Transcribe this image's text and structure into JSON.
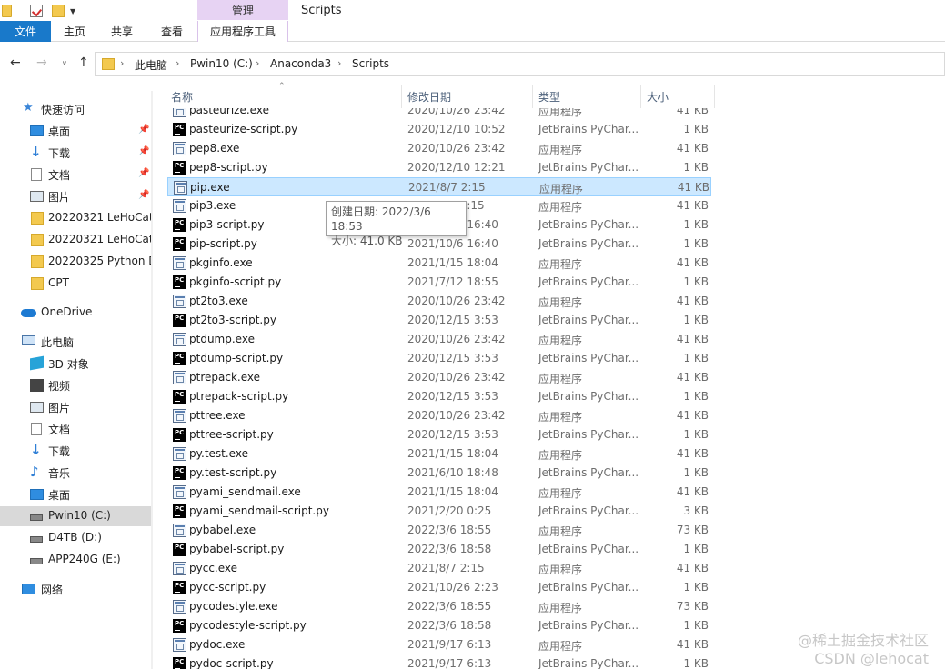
{
  "quick_access_toolbar": {
    "icons": [
      "folder-icon",
      "properties-icon",
      "new-folder-icon",
      "customize-dropdown-icon"
    ]
  },
  "ribbon": {
    "context_group": "管理",
    "window_title": "Scripts",
    "tabs": {
      "file": "文件",
      "home": "主页",
      "share": "共享",
      "view": "查看",
      "app_tools": "应用程序工具"
    },
    "file_tab_color": "#1979ca",
    "context_color": "#e7d3f3"
  },
  "address_bar": {
    "crumbs": [
      "此电脑",
      "Pwin10 (C:)",
      "Anaconda3",
      "Scripts"
    ],
    "separator": "›"
  },
  "nav_pane": {
    "quick_access": "快速访问",
    "pinned": [
      "桌面",
      "下载",
      "文档",
      "图片"
    ],
    "recent": [
      "20220321 LeHoCat",
      "20220321 LeHoCat",
      "20220325 Python D",
      "CPT"
    ],
    "onedrive": "OneDrive",
    "this_pc": "此电脑",
    "pc_items": [
      "3D 对象",
      "视频",
      "图片",
      "文档",
      "下载",
      "音乐",
      "桌面"
    ],
    "drives": [
      "Pwin10 (C:)",
      "D4TB (D:)",
      "APP240G (E:)"
    ],
    "network": "网络",
    "pin_glyph": "📌"
  },
  "columns": {
    "name": "名称",
    "date": "修改日期",
    "type": "类型",
    "size": "大小"
  },
  "files": [
    {
      "name": "pasteurize.exe",
      "date": "2020/10/26 23:42",
      "type": "应用程序",
      "size": "41 KB",
      "kind": "exe"
    },
    {
      "name": "pasteurize-script.py",
      "date": "2020/12/10 10:52",
      "type": "JetBrains PyChar...",
      "size": "1 KB",
      "kind": "py"
    },
    {
      "name": "pep8.exe",
      "date": "2020/10/26 23:42",
      "type": "应用程序",
      "size": "41 KB",
      "kind": "exe"
    },
    {
      "name": "pep8-script.py",
      "date": "2020/12/10 12:21",
      "type": "JetBrains PyChar...",
      "size": "1 KB",
      "kind": "py"
    },
    {
      "name": "pip.exe",
      "date": "2021/8/7 2:15",
      "type": "应用程序",
      "size": "41 KB",
      "kind": "exe",
      "selected": true
    },
    {
      "name": "pip3.exe",
      "date": "2021/8/7 2:15",
      "type": "应用程序",
      "size": "41 KB",
      "kind": "exe"
    },
    {
      "name": "pip3-script.py",
      "date": "2021/10/6 16:40",
      "type": "JetBrains PyChar...",
      "size": "1 KB",
      "kind": "py"
    },
    {
      "name": "pip-script.py",
      "date": "2021/10/6 16:40",
      "type": "JetBrains PyChar...",
      "size": "1 KB",
      "kind": "py"
    },
    {
      "name": "pkginfo.exe",
      "date": "2021/1/15 18:04",
      "type": "应用程序",
      "size": "41 KB",
      "kind": "exe"
    },
    {
      "name": "pkginfo-script.py",
      "date": "2021/7/12 18:55",
      "type": "JetBrains PyChar...",
      "size": "1 KB",
      "kind": "py"
    },
    {
      "name": "pt2to3.exe",
      "date": "2020/10/26 23:42",
      "type": "应用程序",
      "size": "41 KB",
      "kind": "exe"
    },
    {
      "name": "pt2to3-script.py",
      "date": "2020/12/15 3:53",
      "type": "JetBrains PyChar...",
      "size": "1 KB",
      "kind": "py"
    },
    {
      "name": "ptdump.exe",
      "date": "2020/10/26 23:42",
      "type": "应用程序",
      "size": "41 KB",
      "kind": "exe"
    },
    {
      "name": "ptdump-script.py",
      "date": "2020/12/15 3:53",
      "type": "JetBrains PyChar...",
      "size": "1 KB",
      "kind": "py"
    },
    {
      "name": "ptrepack.exe",
      "date": "2020/10/26 23:42",
      "type": "应用程序",
      "size": "41 KB",
      "kind": "exe"
    },
    {
      "name": "ptrepack-script.py",
      "date": "2020/12/15 3:53",
      "type": "JetBrains PyChar...",
      "size": "1 KB",
      "kind": "py"
    },
    {
      "name": "pttree.exe",
      "date": "2020/10/26 23:42",
      "type": "应用程序",
      "size": "41 KB",
      "kind": "exe"
    },
    {
      "name": "pttree-script.py",
      "date": "2020/12/15 3:53",
      "type": "JetBrains PyChar...",
      "size": "1 KB",
      "kind": "py"
    },
    {
      "name": "py.test.exe",
      "date": "2021/1/15 18:04",
      "type": "应用程序",
      "size": "41 KB",
      "kind": "exe"
    },
    {
      "name": "py.test-script.py",
      "date": "2021/6/10 18:48",
      "type": "JetBrains PyChar...",
      "size": "1 KB",
      "kind": "py"
    },
    {
      "name": "pyami_sendmail.exe",
      "date": "2021/1/15 18:04",
      "type": "应用程序",
      "size": "41 KB",
      "kind": "exe"
    },
    {
      "name": "pyami_sendmail-script.py",
      "date": "2021/2/20 0:25",
      "type": "JetBrains PyChar...",
      "size": "3 KB",
      "kind": "py"
    },
    {
      "name": "pybabel.exe",
      "date": "2022/3/6 18:55",
      "type": "应用程序",
      "size": "73 KB",
      "kind": "exe"
    },
    {
      "name": "pybabel-script.py",
      "date": "2022/3/6 18:58",
      "type": "JetBrains PyChar...",
      "size": "1 KB",
      "kind": "py"
    },
    {
      "name": "pycc.exe",
      "date": "2021/8/7 2:15",
      "type": "应用程序",
      "size": "41 KB",
      "kind": "exe"
    },
    {
      "name": "pycc-script.py",
      "date": "2021/10/26 2:23",
      "type": "JetBrains PyChar...",
      "size": "1 KB",
      "kind": "py"
    },
    {
      "name": "pycodestyle.exe",
      "date": "2022/3/6 18:55",
      "type": "应用程序",
      "size": "73 KB",
      "kind": "exe"
    },
    {
      "name": "pycodestyle-script.py",
      "date": "2022/3/6 18:58",
      "type": "JetBrains PyChar...",
      "size": "1 KB",
      "kind": "py"
    },
    {
      "name": "pydoc.exe",
      "date": "2021/9/17 6:13",
      "type": "应用程序",
      "size": "41 KB",
      "kind": "exe"
    },
    {
      "name": "pydoc-script.py",
      "date": "2021/9/17 6:13",
      "type": "JetBrains PyChar...",
      "size": "1 KB",
      "kind": "py"
    }
  ],
  "tooltip": {
    "created": "创建日期: 2022/3/6 18:53",
    "size": "大小: 41.0 KB"
  },
  "watermark": {
    "line1": "@稀土掘金技术社区",
    "line2": "CSDN @lehocat"
  },
  "colors": {
    "selection": "#cce8ff",
    "selection_border": "#99d1ff",
    "header_text": "#4c607a"
  }
}
